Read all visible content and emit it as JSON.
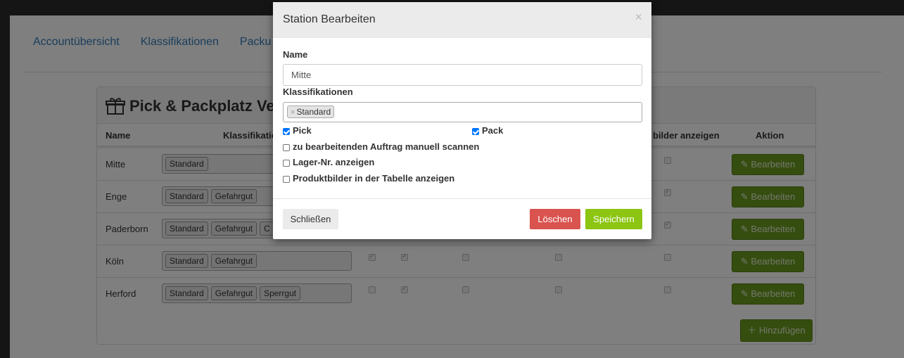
{
  "nav": {
    "tabs": [
      "Accountübersicht",
      "Klassifikationen",
      "Packu"
    ]
  },
  "panel": {
    "title": "Pick & Packplatz Ve",
    "columns": {
      "name": "Name",
      "klass": "Klassifikatio",
      "bilder": "bilder anzeigen",
      "aktion": "Aktion"
    },
    "rows": [
      {
        "name": "Mitte",
        "tags": [
          "Standard"
        ],
        "checks": [],
        "img": false
      },
      {
        "name": "Enge",
        "tags": [
          "Standard",
          "Gefahrgut"
        ],
        "checks": [],
        "img": true
      },
      {
        "name": "Paderborn",
        "tags": [
          "Standard",
          "Gefahrgut",
          "C"
        ],
        "checks": [],
        "img": true
      },
      {
        "name": "Köln",
        "tags": [
          "Standard",
          "Gefahrgut"
        ],
        "checks": [
          true,
          true,
          false,
          false
        ],
        "img": false
      },
      {
        "name": "Herford",
        "tags": [
          "Standard",
          "Gefahrgut",
          "Sperrgut"
        ],
        "checks": [
          false,
          true,
          false,
          false
        ],
        "img": false
      }
    ],
    "edit_label": "Bearbeiten",
    "add_label": "Hinzufügen"
  },
  "modal": {
    "title": "Station Bearbeiten",
    "close_x": "×",
    "name_label": "Name",
    "name_value": "Mitte",
    "klass_label": "Klassifikationen",
    "klass_tag": "Standard",
    "klass_tag_remove": "×",
    "pick_label": "Pick",
    "pick_checked": true,
    "pack_label": "Pack",
    "pack_checked": true,
    "scan_label": "zu bearbeitenden Auftrag manuell scannen",
    "scan_checked": false,
    "lager_label": "Lager-Nr. anzeigen",
    "lager_checked": false,
    "bilder_label": "Produktbilder in der Tabelle anzeigen",
    "bilder_checked": false,
    "close_button": "Schließen",
    "delete_button": "Löschen",
    "save_button": "Speichern"
  },
  "colors": {
    "save": "#8cc512",
    "delete": "#d9534f",
    "edit": "#6a9a1f",
    "link": "#337ab7"
  }
}
